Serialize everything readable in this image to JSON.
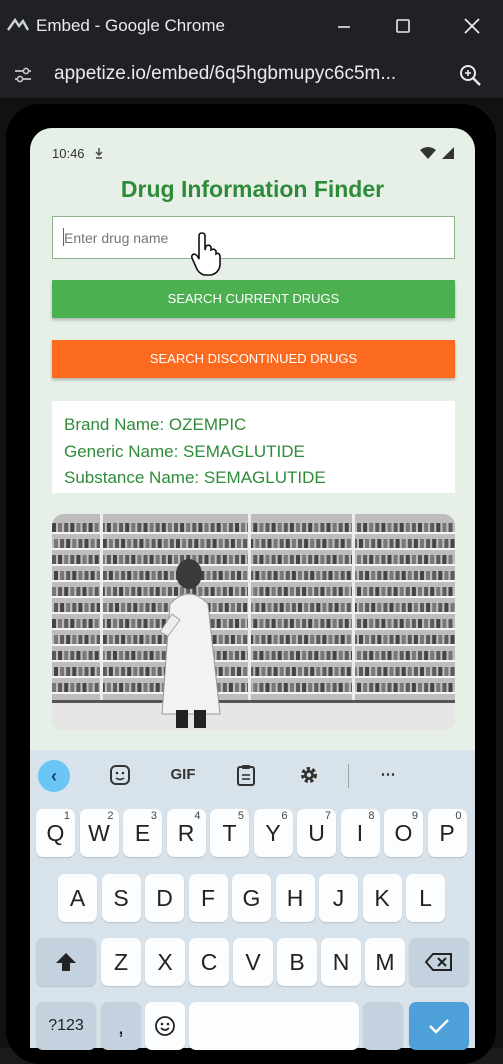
{
  "window": {
    "title": "Embed - Google Chrome",
    "controls": [
      "minimize-icon",
      "maximize-icon",
      "close-icon"
    ]
  },
  "addressbar": {
    "url": "appetize.io/embed/6q5hgbmupyc6c5m..."
  },
  "phone": {
    "status": {
      "time": "10:46"
    },
    "app": {
      "title": "Drug Information Finder",
      "search": {
        "placeholder": "Enter drug name",
        "value": ""
      },
      "buttons": {
        "current": "SEARCH CURRENT DRUGS",
        "discontinued": "SEARCH DISCONTINUED DRUGS"
      },
      "result": {
        "brand": "Brand Name: OZEMPIC",
        "generic": "Generic Name: SEMAGLUTIDE",
        "substance": "Substance Name: SEMAGLUTIDE"
      }
    },
    "colors": {
      "accent_green": "#2e8b3a",
      "button_green": "#4caf50",
      "button_orange": "#fb6a1e"
    },
    "keyboard": {
      "toolbar": {
        "gif": "GIF"
      },
      "row1": [
        {
          "k": "Q",
          "h": "1"
        },
        {
          "k": "W",
          "h": "2"
        },
        {
          "k": "E",
          "h": "3"
        },
        {
          "k": "R",
          "h": "4"
        },
        {
          "k": "T",
          "h": "5"
        },
        {
          "k": "Y",
          "h": "6"
        },
        {
          "k": "U",
          "h": "7"
        },
        {
          "k": "I",
          "h": "8"
        },
        {
          "k": "O",
          "h": "9"
        },
        {
          "k": "P",
          "h": "0"
        }
      ],
      "row2": [
        "A",
        "S",
        "D",
        "F",
        "G",
        "H",
        "J",
        "K",
        "L"
      ],
      "row3": [
        "Z",
        "X",
        "C",
        "V",
        "B",
        "N",
        "M"
      ],
      "bottom": {
        "sym": "?123",
        "comma": ","
      }
    }
  }
}
